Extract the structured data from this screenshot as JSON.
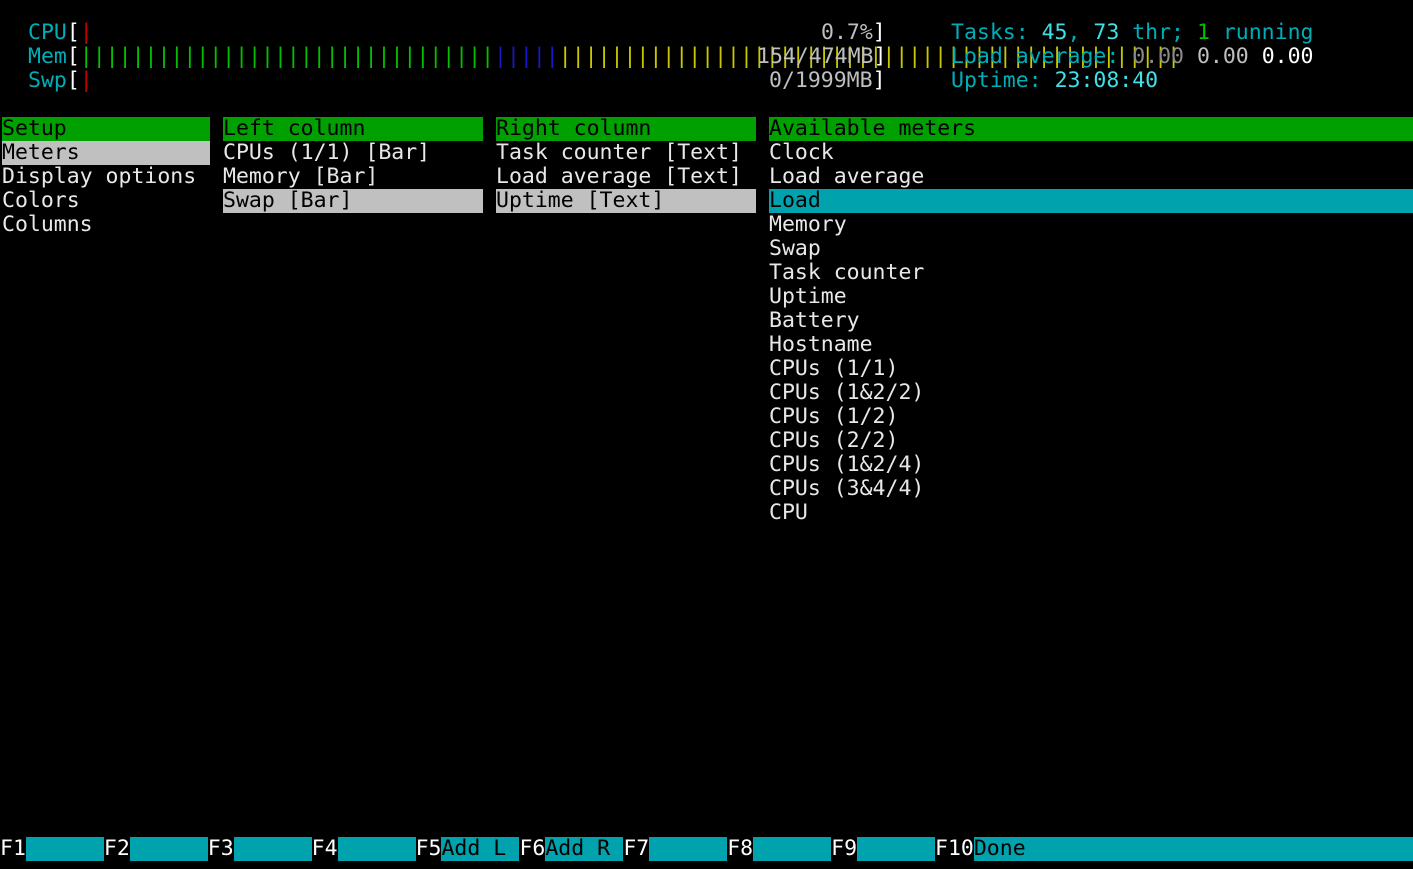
{
  "header": {
    "cpu": {
      "label": "CPU",
      "value": "0.7%"
    },
    "mem": {
      "label": "Mem",
      "value": "154/474MB"
    },
    "swp": {
      "label": "Swp",
      "value": "0/1999MB"
    },
    "tasks": {
      "label": "Tasks: ",
      "count": "45",
      "sep": ", ",
      "threads": "73",
      "thr_label": " thr; ",
      "running": "1",
      "running_label": " running"
    },
    "load": {
      "label": "Load average: ",
      "l1": "0.00",
      "l5": "0.00",
      "l15": "0.00"
    },
    "uptime": {
      "label": "Uptime: ",
      "value": "23:08:40"
    }
  },
  "setup": {
    "title": "Setup",
    "items": [
      "Meters",
      "Display options",
      "Colors",
      "Columns"
    ]
  },
  "left_column": {
    "title": "Left column",
    "items": [
      "CPUs (1/1) [Bar]",
      "Memory [Bar]",
      "Swap [Bar]"
    ]
  },
  "right_column": {
    "title": "Right column",
    "items": [
      "Task counter [Text]",
      "Load average [Text]",
      "Uptime [Text]"
    ]
  },
  "available": {
    "title": "Available meters",
    "items": [
      "Clock",
      "Load average",
      "Load",
      "Memory",
      "Swap",
      "Task counter",
      "Uptime",
      "Battery",
      "Hostname",
      "CPUs (1/1)",
      "CPUs (1&2/2)",
      "CPUs (1/2)",
      "CPUs (2/2)",
      "CPUs (1&2/4)",
      "CPUs (3&4/4)",
      "CPU"
    ]
  },
  "footer": [
    {
      "key": "F1",
      "label": ""
    },
    {
      "key": "F2",
      "label": ""
    },
    {
      "key": "F3",
      "label": ""
    },
    {
      "key": "F4",
      "label": ""
    },
    {
      "key": "F5",
      "label": "Add L "
    },
    {
      "key": "F6",
      "label": "Add R "
    },
    {
      "key": "F7",
      "label": ""
    },
    {
      "key": "F8",
      "label": ""
    },
    {
      "key": "F9",
      "label": ""
    },
    {
      "key": "F10",
      "label": "Done"
    }
  ],
  "colors": {
    "cyan": "#00a3ad",
    "green": "#00a000",
    "selected_grey": "#c0c0c0"
  }
}
